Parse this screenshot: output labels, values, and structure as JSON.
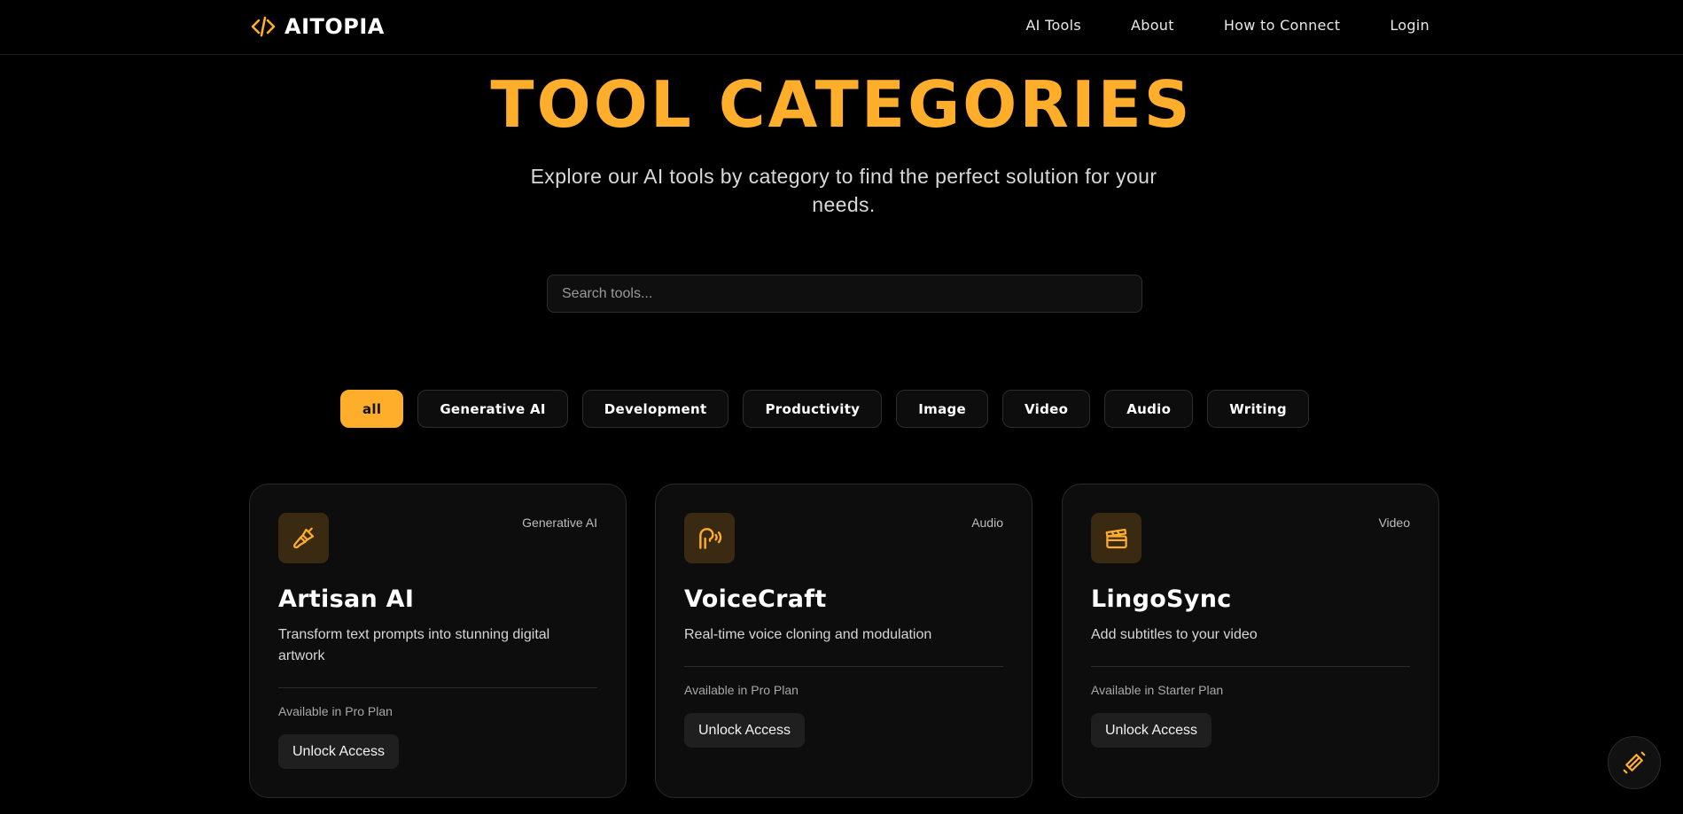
{
  "nav": {
    "brand_name": "AITOPIA",
    "links": [
      "AI Tools",
      "About",
      "How to Connect",
      "Login"
    ]
  },
  "hero": {
    "title": "TOOL CATEGORIES",
    "subtitle": "Explore our AI tools by category to find the perfect solution for your needs."
  },
  "search": {
    "placeholder": "Search tools..."
  },
  "filters": {
    "active": "all",
    "items": [
      "all",
      "Generative AI",
      "Development",
      "Productivity",
      "Image",
      "Video",
      "Audio",
      "Writing"
    ]
  },
  "cards": [
    {
      "icon": "paintbrush-icon",
      "category": "Generative AI",
      "title": "Artisan AI",
      "description": "Transform text prompts into stunning digital artwork",
      "plan": "Available in Pro Plan",
      "button": "Unlock Access"
    },
    {
      "icon": "voice-icon",
      "category": "Audio",
      "title": "VoiceCraft",
      "description": "Real-time voice cloning and modulation",
      "plan": "Available in Pro Plan",
      "button": "Unlock Access"
    },
    {
      "icon": "clapperboard-icon",
      "category": "Video",
      "title": "LingoSync",
      "description": "Add subtitles to your video",
      "plan": "Available in Starter Plan",
      "button": "Unlock Access"
    }
  ],
  "colors": {
    "accent": "#FFAE2B",
    "background": "#000000",
    "card": "#0D0D0D"
  },
  "fab": {
    "icon": "brand-logo-icon"
  }
}
